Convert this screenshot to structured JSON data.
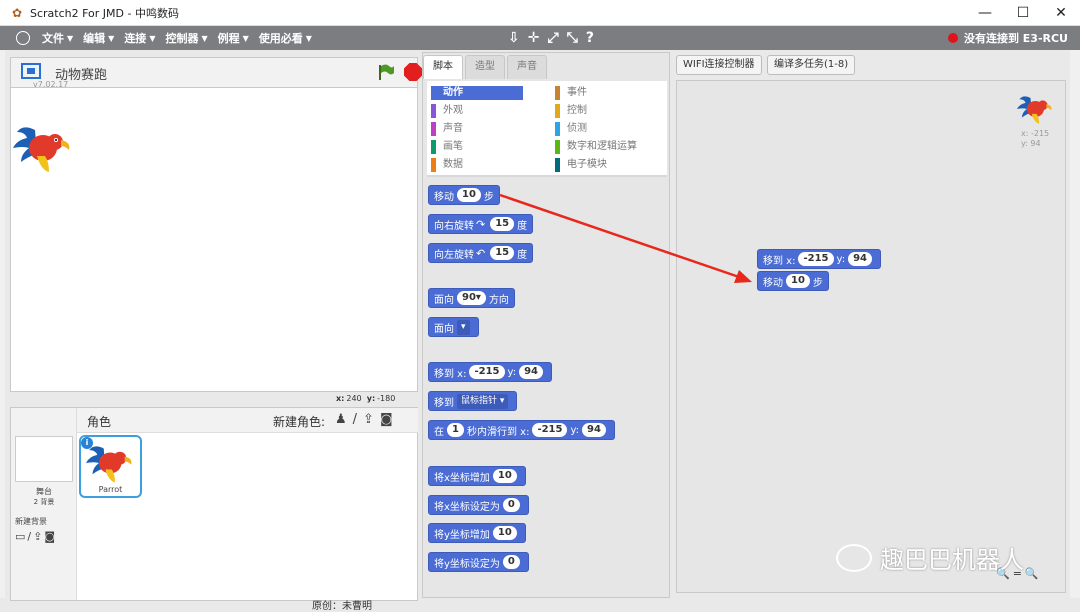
{
  "window": {
    "title": "Scratch2 For JMD - 中鸣数码",
    "min": "—",
    "max": "☐",
    "close": "✕"
  },
  "menu": {
    "items": [
      "文件",
      "编辑",
      "连接",
      "控制器",
      "例程",
      "使用必看"
    ],
    "caret": "▼",
    "tools": [
      "⇩",
      "✛",
      "⤢",
      "⤡",
      "?"
    ],
    "status_text": "没有连接到 E3-RCU",
    "status_color": "#e0131a"
  },
  "stage": {
    "project_name": "动物赛跑",
    "version": "v7.02.17",
    "coords": {
      "x_label": "x:",
      "x": "240",
      "y_label": "y:",
      "y": "-180"
    }
  },
  "sprites": {
    "header": "角色",
    "new_sprite": "新建角色:",
    "new_icons": [
      "♟",
      "/",
      "⇪",
      "◙"
    ],
    "stage_label": "舞台",
    "bg_count": "2 背景",
    "new_bg": "新建背景",
    "bg_icons": [
      "▭",
      "/",
      "⇪",
      "◙"
    ],
    "list": [
      {
        "name": "Parrot",
        "info": "i"
      }
    ]
  },
  "tabs": [
    {
      "label": "脚本",
      "active": true
    },
    {
      "label": "造型"
    },
    {
      "label": "声音"
    }
  ],
  "categories": [
    {
      "label": "动作",
      "color": "#4a6cd4",
      "active": true
    },
    {
      "label": "事件",
      "color": "#c88330"
    },
    {
      "label": "外观",
      "color": "#8a55d7"
    },
    {
      "label": "控制",
      "color": "#e1a91a"
    },
    {
      "label": "声音",
      "color": "#bb42c3"
    },
    {
      "label": "侦测",
      "color": "#2ca5e2"
    },
    {
      "label": "画笔",
      "color": "#0e9a6c"
    },
    {
      "label": "数字和逻辑运算",
      "color": "#5cb712"
    },
    {
      "label": "数据",
      "color": "#ee7d16"
    },
    {
      "label": "电子模块",
      "color": "#006b7a"
    }
  ],
  "blocks": {
    "move": {
      "pre": "移动",
      "val": "10",
      "post": "步"
    },
    "turn_right": {
      "pre": "向右旋转",
      "icon": "↷",
      "val": "15",
      "post": "度"
    },
    "turn_left": {
      "pre": "向左旋转",
      "icon": "↶",
      "val": "15",
      "post": "度"
    },
    "point_dir": {
      "pre": "面向",
      "val": "90▾",
      "post": "方向"
    },
    "point_towards": {
      "pre": "面向",
      "dd": "▾"
    },
    "goto_xy": {
      "pre": "移到 x:",
      "x": "-215",
      "mid": "y:",
      "y": "94"
    },
    "goto_target": {
      "pre": "移到",
      "dd": "鼠标指针 ▾"
    },
    "glide": {
      "pre": "在",
      "secs": "1",
      "mid1": "秒内滑行到 x:",
      "x": "-215",
      "mid2": "y:",
      "y": "94"
    },
    "change_x": {
      "pre": "将x坐标增加",
      "val": "10"
    },
    "set_x": {
      "pre": "将x坐标设定为",
      "val": "0"
    },
    "change_y": {
      "pre": "将y坐标增加",
      "val": "10"
    },
    "set_y": {
      "pre": "将y坐标设定为",
      "val": "0"
    }
  },
  "buttons": {
    "wifi": "WIFI连接控制器",
    "multitask": "编译多任务(1-8)"
  },
  "script": {
    "goto": {
      "pre": "移到 x:",
      "x": "-215",
      "mid": "y:",
      "y": "94"
    },
    "move": {
      "pre": "移动",
      "val": "10",
      "post": "步"
    },
    "sprite_x": "x: -215",
    "sprite_y": "y: 94"
  },
  "zoom_icons": [
    "🔍",
    "=",
    "🔍"
  ],
  "watermark": "趣巴巴机器人",
  "bottom_text": "原创：未曹明"
}
